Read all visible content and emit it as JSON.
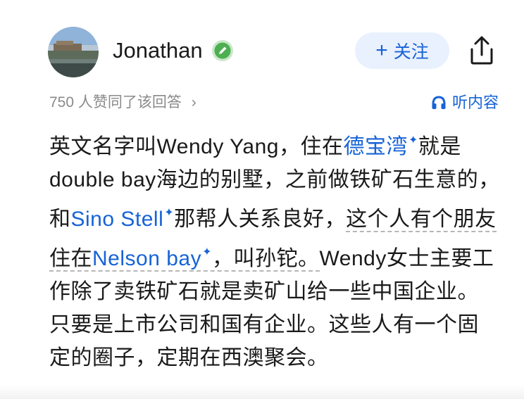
{
  "author": {
    "name": "Jonathan",
    "avatar_icon": "landscape-photo-avatar",
    "badge_icon": "pencil-badge-icon",
    "badge_color": "#4caf50"
  },
  "actions": {
    "follow_plus": "+",
    "follow_label": "关注",
    "share_icon": "share-icon"
  },
  "meta": {
    "votes_text": "750 人赞同了该回答",
    "votes_chevron": "›",
    "listen_label": "听内容",
    "listen_icon": "headphones-icon"
  },
  "colors": {
    "accent": "#1763d6",
    "follow_bg": "#e9f1ff",
    "text": "#1a1a1a",
    "muted": "#8a8a8a"
  },
  "content": {
    "p1": "英文名字叫Wendy Yang，住在",
    "link1": "德宝湾",
    "p2": "就是double bay海边的别墅，之前做铁矿石生意的，和",
    "link2": "Sino Stell",
    "p3": "那帮人关系良好，",
    "p4": "这个人有个朋友住在",
    "link3": "Nelson bay",
    "p5": "，叫孙铊。",
    "p6": "Wendy女士主要工作除了卖铁矿石就是卖矿山给一些中国企业。只要是上市公司和国有企业。这些人有一个固定的圈子，定期在西澳聚会。",
    "sup": "✦"
  }
}
